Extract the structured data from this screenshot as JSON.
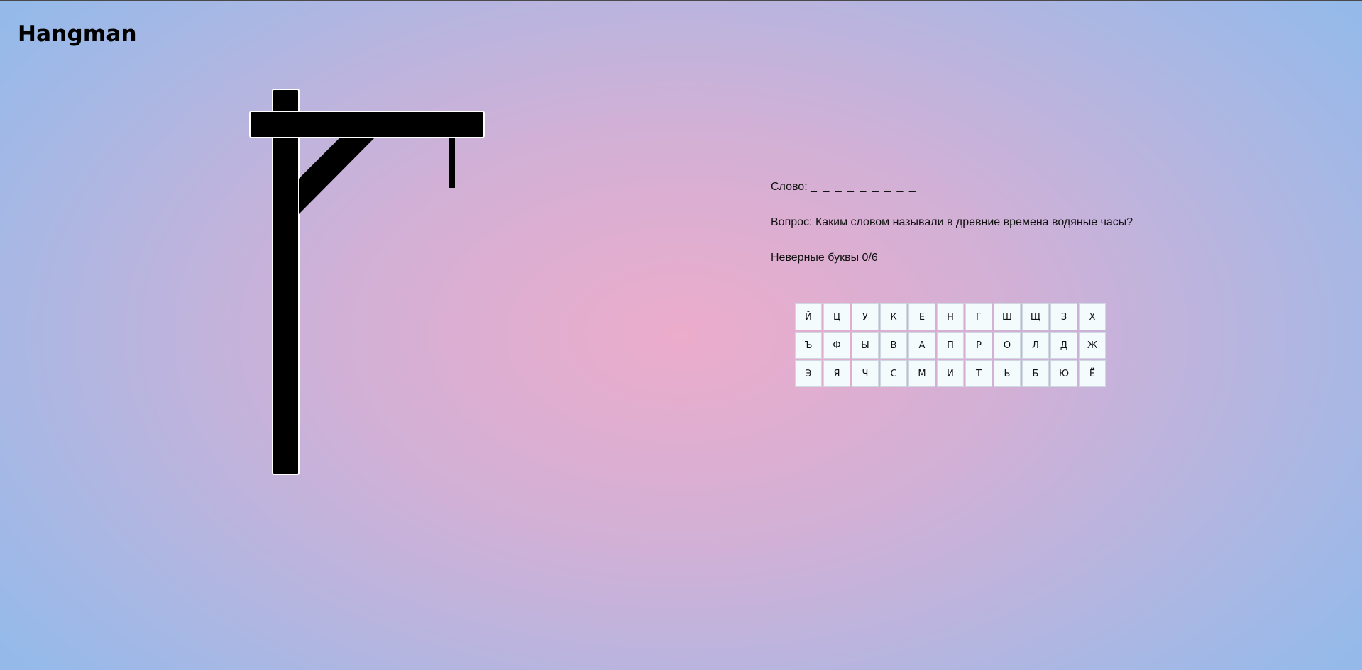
{
  "app": {
    "title": "Hangman"
  },
  "game": {
    "word_label": "Слово:",
    "word_mask": "_ _ _ _ _ _ _ _ _",
    "question_label": "Вопрос:",
    "question_text": "Каким словом называли в древние времена водяные часы?",
    "wrong_label": "Неверные буквы",
    "wrong_count": "0/6"
  },
  "keyboard": {
    "rows": [
      [
        "Й",
        "Ц",
        "У",
        "К",
        "Е",
        "Н",
        "Г",
        "Ш",
        "Щ",
        "З",
        "Х"
      ],
      [
        "Ъ",
        "Ф",
        "Ы",
        "В",
        "А",
        "П",
        "Р",
        "О",
        "Л",
        "Д",
        "Ж"
      ],
      [
        "Э",
        "Я",
        "Ч",
        "С",
        "М",
        "И",
        "Т",
        "Ь",
        "Б",
        "Ю",
        "Ё"
      ]
    ]
  },
  "colors": {
    "gallows_fill": "#000000",
    "gallows_outline": "#ffffff",
    "key_background": "#f3fbfd"
  },
  "icons": {
    "gallows": "gallows-icon"
  }
}
